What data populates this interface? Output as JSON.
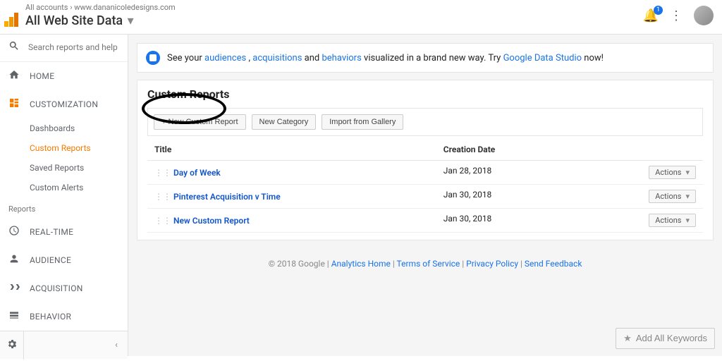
{
  "header": {
    "breadcrumb_all": "All accounts",
    "breadcrumb_sep": "›",
    "breadcrumb_domain": "www.dananicoledesigns.com",
    "view_title": "All Web Site Data",
    "bell_count": "1"
  },
  "sidebar": {
    "search_placeholder": "Search reports and help",
    "home": "HOME",
    "customization": "CUSTOMIZATION",
    "subs": {
      "dashboards": "Dashboards",
      "custom_reports": "Custom Reports",
      "saved_reports": "Saved Reports",
      "custom_alerts": "Custom Alerts"
    },
    "reports_header": "Reports",
    "realtime": "REAL-TIME",
    "audience": "AUDIENCE",
    "acquisition": "ACQUISITION",
    "behavior": "BEHAVIOR"
  },
  "banner": {
    "pre": "See your ",
    "audiences": "audiences",
    "sep1": ", ",
    "acquisitions": "acquisitions",
    "sep2": " and ",
    "behaviors": "behaviors",
    "mid": " visualized in a brand new way. Try ",
    "gds": "Google Data Studio",
    "post": " now!"
  },
  "panel": {
    "title": "Custom Reports",
    "btn_new": "+ New Custom Report",
    "btn_cat": "New Category",
    "btn_import": "Import from Gallery",
    "col_title": "Title",
    "col_date": "Creation Date",
    "actions_label": "Actions",
    "rows": [
      {
        "title": "Day of Week",
        "date": "Jan 28, 2018"
      },
      {
        "title": "Pinterest Acquisition v Time",
        "date": "Jan 30, 2018"
      },
      {
        "title": "New Custom Report",
        "date": "Jan 30, 2018"
      }
    ]
  },
  "footer": {
    "copyright": "© 2018 Google",
    "sep": " | ",
    "analytics_home": "Analytics Home",
    "tos": "Terms of Service",
    "privacy": "Privacy Policy",
    "feedback": "Send Feedback"
  },
  "add_keywords": "Add All Keywords"
}
